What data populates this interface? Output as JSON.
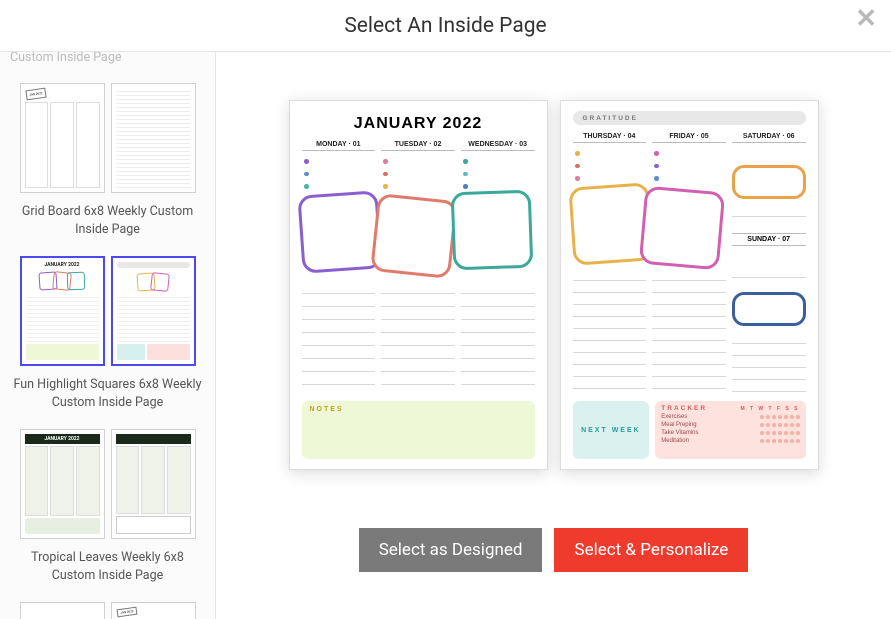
{
  "modal": {
    "title": "Select An Inside Page"
  },
  "sidebar": {
    "truncated_label": "Custom Inside Page",
    "items": [
      {
        "label": "Grid Board 6x8 Weekly Custom Inside Page",
        "thumb_badge": "JAN 2022"
      },
      {
        "label": "Fun Highlight Squares 6x8 Weekly Custom Inside Page",
        "thumb_title": "JANUARY 2022"
      },
      {
        "label": "Tropical Leaves Weekly 6x8 Custom Inside Page",
        "thumb_title": "JANUARY 2022"
      },
      {
        "label": "",
        "thumb_badge": "JAN 2022"
      }
    ]
  },
  "preview": {
    "left": {
      "title": "JANUARY 2022",
      "days": [
        {
          "label": "MONDAY · 01",
          "bullet_colors": [
            "#8a5fcf",
            "#5f8acb",
            "#45b5a8"
          ],
          "square_color": "#8a5fcf"
        },
        {
          "label": "TUESDAY · 02",
          "bullet_colors": [
            "#e07aa0",
            "#d66f5e",
            "#e8b24a"
          ],
          "square_color": "#e07a6b"
        },
        {
          "label": "WEDNESDAY · 03",
          "bullet_colors": [
            "#3aa89a",
            "#5fb8c8",
            "#4a7fc0"
          ],
          "square_color": "#3aa89a"
        }
      ],
      "notes_label": "NOTES"
    },
    "right": {
      "gratitude_label": "GRATITUDE",
      "days": [
        {
          "label": "THURSDAY · 04",
          "bullet_colors": [
            "#e8b24a",
            "#d66f5e",
            "#e07aa0"
          ],
          "square_color": "#e8b24a"
        },
        {
          "label": "FRIDAY · 05",
          "bullet_colors": [
            "#d25fb0",
            "#8a5fcf",
            "#5f8acb"
          ],
          "square_color": "#d25fb0"
        },
        {
          "label": "SATURDAY · 06",
          "capsule_color": "#e8a24a",
          "sunday_label": "SUNDAY · 07",
          "sunday_bullets": [
            "#4a7fc0",
            "#3aa89a",
            "#8a5fcf"
          ],
          "sunday_capsule": "#3a5f9a"
        }
      ],
      "next_week_label": "NEXT WEEK",
      "tracker": {
        "title": "TRACKER",
        "days_row": "M  T  W  T  F  S  S",
        "items": [
          "Exercises",
          "Meal Preping",
          "Take Vitamins",
          "Meditation"
        ]
      }
    }
  },
  "buttons": {
    "designed": "Select as Designed",
    "personalize": "Select & Personalize"
  }
}
